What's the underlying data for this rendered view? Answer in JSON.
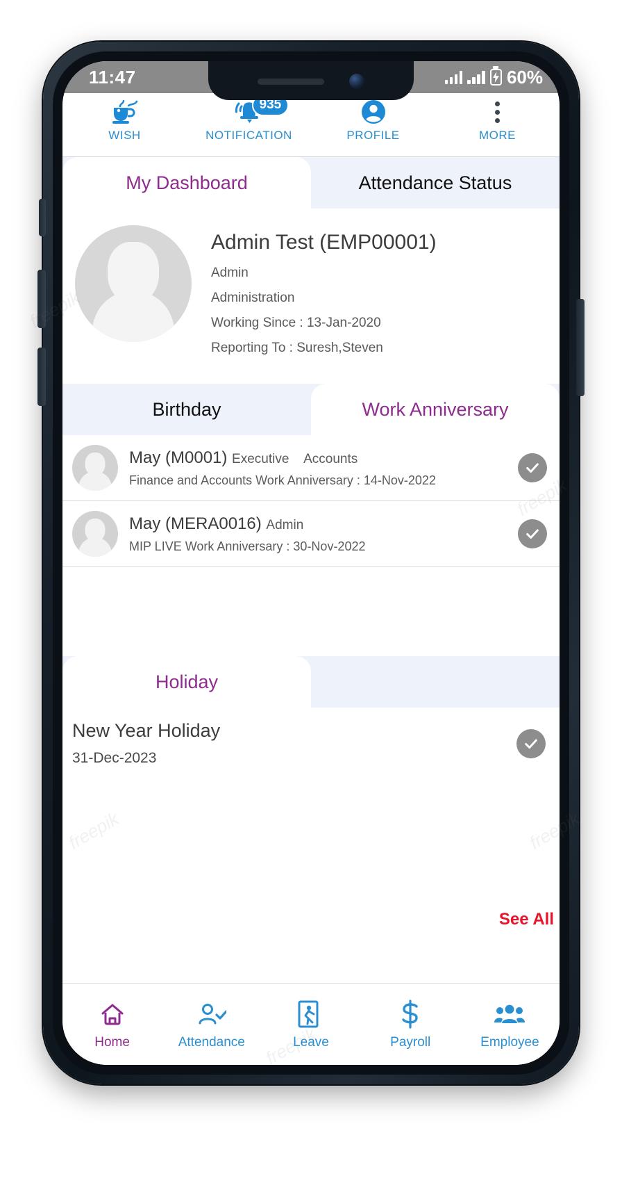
{
  "status_bar": {
    "time": "11:47",
    "battery_percent": "60%",
    "signal_icon": "signal-bars-icon",
    "battery_icon": "battery-charging-icon"
  },
  "top_nav": {
    "items": [
      {
        "label": "WISH",
        "icon": "wish-teacup-icon",
        "badge": ""
      },
      {
        "label": "NOTIFICATION",
        "icon": "bell-icon",
        "badge": "935"
      },
      {
        "label": "PROFILE",
        "icon": "user-circle-icon",
        "badge": ""
      },
      {
        "label": "MORE",
        "icon": "kebab-menu-icon",
        "badge": ""
      }
    ]
  },
  "main_tabs": {
    "items": [
      {
        "label": "My Dashboard",
        "active": true
      },
      {
        "label": "Attendance Status",
        "active": false
      }
    ]
  },
  "profile": {
    "avatar_icon": "profile-placeholder-avatar",
    "name": "Admin Test (EMP00001)",
    "role": "Admin",
    "department": "Administration",
    "working_since": "Working Since : 13-Jan-2020",
    "reporting_to": "Reporting To : Suresh,Steven"
  },
  "celebration_tabs": {
    "items": [
      {
        "label": "Birthday",
        "active": false
      },
      {
        "label": "Work Anniversary",
        "active": true
      }
    ]
  },
  "anniversary_list": [
    {
      "avatar_icon": "person-placeholder-avatar",
      "name": "May (M0001)",
      "designation": "Executive",
      "department": "Accounts",
      "detail": "Finance and Accounts Work Anniversary : 14-Nov-2022",
      "action_icon": "check-circle-icon"
    },
    {
      "avatar_icon": "person-placeholder-avatar",
      "name": "May (MERA0016)",
      "designation": "Admin",
      "department": "",
      "detail": "MIP LIVE Work Anniversary : 30-Nov-2022",
      "action_icon": "check-circle-icon"
    }
  ],
  "holiday_tabs": {
    "items": [
      {
        "label": "Holiday",
        "active": true
      }
    ]
  },
  "holiday": {
    "title": "New Year Holiday",
    "date": "31-Dec-2023",
    "action_icon": "check-circle-icon"
  },
  "see_all": {
    "label": "See All",
    "color": "#e8142b"
  },
  "bottom_nav": {
    "items": [
      {
        "label": "Home",
        "icon": "home-icon",
        "active": true
      },
      {
        "label": "Attendance",
        "icon": "user-check-icon",
        "active": false
      },
      {
        "label": "Leave",
        "icon": "running-person-exit-icon",
        "active": false
      },
      {
        "label": "Payroll",
        "icon": "dollar-icon",
        "active": false
      },
      {
        "label": "Employee",
        "icon": "people-group-icon",
        "active": false
      }
    ]
  },
  "theme": {
    "accent_blue": "#2a8fd0",
    "accent_purple": "#8e2c8e",
    "tab_bg": "#eef2fb",
    "alert_red": "#e8142b"
  },
  "watermark": {
    "text": "freepik"
  }
}
